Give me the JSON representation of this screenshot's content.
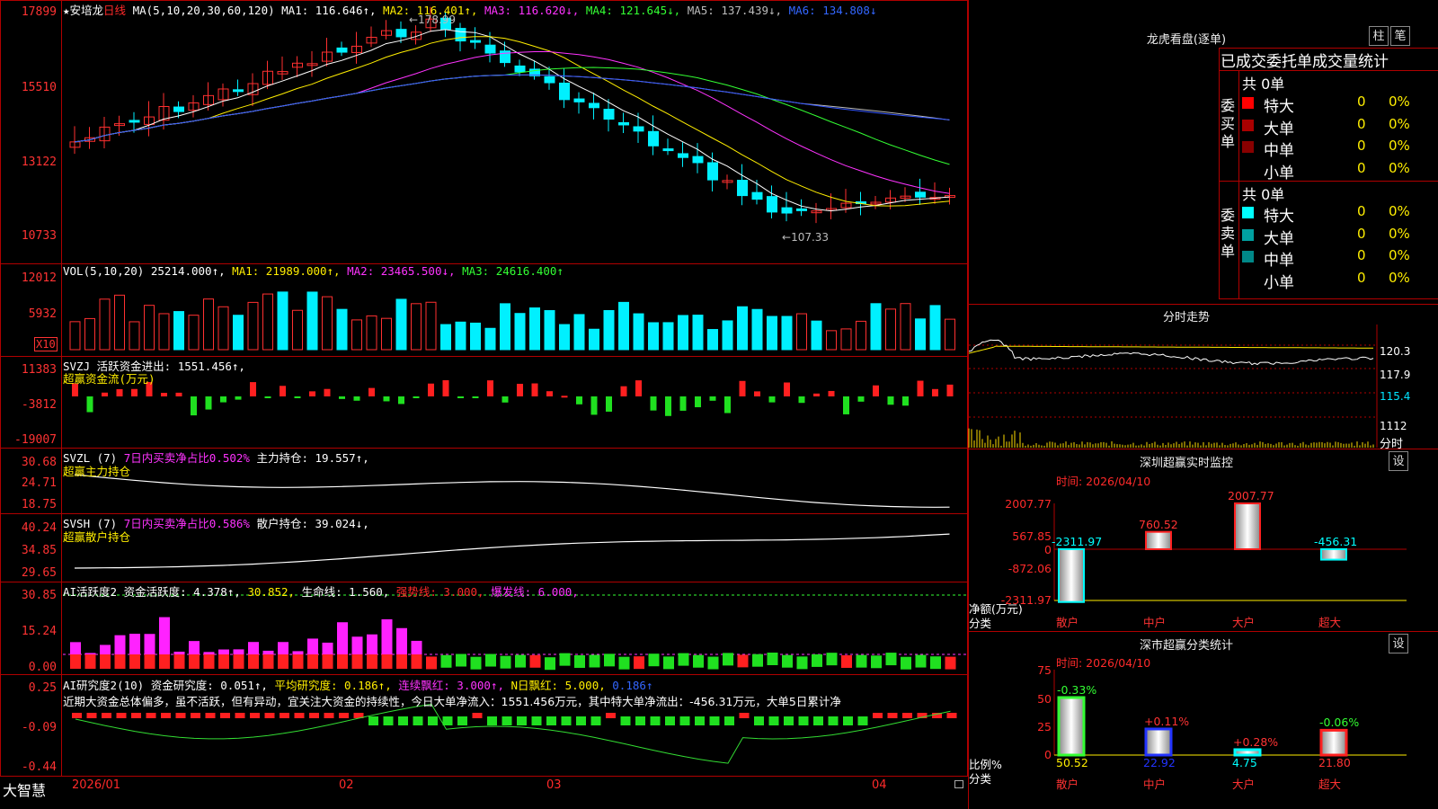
{
  "header": {
    "stock_name": "★安培龙",
    "period": "日线",
    "ma_label": "MA(5,10,20,30,60,120)",
    "ma1": "MA1: 116.646↑,",
    "ma2": "MA2: 116.401↑,",
    "ma3": "MA3: 116.620↓,",
    "ma4": "MA4: 121.645↓,",
    "ma5": "MA5: 137.439↓,",
    "ma6": "MA6: 134.808↓",
    "high_mark": "178.99",
    "low_mark": "107.33"
  },
  "price_axis": [
    "17899",
    "15510",
    "13122",
    "10733"
  ],
  "vol": {
    "label": "VOL(5,10,20)",
    "value": "25214.000↑,",
    "ma1": "MA1: 21989.000↑,",
    "ma2": "MA2: 23465.500↓,",
    "ma3": "MA3: 24616.400↑",
    "axis": [
      "12012",
      "5932"
    ],
    "unit": "X10"
  },
  "svzj": {
    "line1_a": "SVZJ  活跃资金进出: ",
    "line1_b": "1551.456↑,",
    "line2": "超赢资金流(万元)",
    "axis": [
      "11383",
      "-3812",
      "-19007"
    ]
  },
  "svzl": {
    "label": "SVZL (7)",
    "part1": "7日内买卖净占比0.502%",
    "part2": "主力持仓: 19.557↑,",
    "line2": "超赢主力持仓",
    "axis": [
      "30.68",
      "24.71",
      "18.75"
    ]
  },
  "svsh": {
    "label": "SVSH (7)",
    "part1": "7日内买卖净占比0.586%",
    "part2": "散户持仓: 39.024↓,",
    "line2": "超赢散户持仓",
    "axis": [
      "40.24",
      "34.85",
      "29.65"
    ]
  },
  "ai1": {
    "label": "AI活跃度2",
    "a": "资金活跃度: 4.378↑,",
    "b": "30.852,",
    "c": "生命线: 1.560,",
    "d": "强势线: 3.000,",
    "e": "爆发线: 6.000,",
    "axis": [
      "30.85",
      "15.24",
      "0.00"
    ]
  },
  "ai2": {
    "label": "AI研究度2(10)",
    "a": "资金研究度: 0.051↑,",
    "b": "平均研究度: 0.186↑,",
    "c": "连续飘红: 3.000↑,",
    "d": "N日飘红: 5.000,",
    "e": "0.186↑",
    "comment": "近期大资金总体偏多，虽不活跃，但有异动，宜关注大资金的持续性，今日大单净流入：1551.456万元，其中特大单净流出：-456.31万元，大单5日累计净",
    "axis": [
      "0.25",
      "-0.09",
      "-0.44"
    ]
  },
  "bottom": {
    "brand": "大智慧",
    "dates": [
      "2026/01",
      "02",
      "03",
      "04"
    ]
  },
  "dragon": {
    "title": "龙虎看盘(逐单)",
    "btn1": "柱",
    "btn2": "笔",
    "subtitle": "已成交委托单成交量统计",
    "buy_side": "委买单",
    "sell_side": "委卖单",
    "buy_total": "共 0单",
    "sell_total": "共 0单",
    "buy_rows": [
      {
        "name": "特大",
        "n": "0",
        "pct": "0%"
      },
      {
        "name": "大单",
        "n": "0",
        "pct": "0%"
      },
      {
        "name": "中单",
        "n": "0",
        "pct": "0%"
      },
      {
        "name": "小单",
        "n": "0",
        "pct": "0%"
      }
    ],
    "sell_rows": [
      {
        "name": "特大",
        "n": "0",
        "pct": "0%"
      },
      {
        "name": "大单",
        "n": "0",
        "pct": "0%"
      },
      {
        "name": "中单",
        "n": "0",
        "pct": "0%"
      },
      {
        "name": "小单",
        "n": "0",
        "pct": "0%"
      }
    ]
  },
  "minute": {
    "title": "分时走势",
    "axis": [
      "120.3",
      "117.9",
      "115.4",
      "1112"
    ],
    "foot": "分时"
  },
  "sz_monitor": {
    "title": "深圳超赢实时监控",
    "btn": "设",
    "time": "时间: 2026/04/10",
    "axis": [
      "2007.77",
      "567.85",
      "0",
      "-872.06",
      "-2311.97"
    ],
    "ylabel1": "净额(万元)",
    "ylabel2": "分类",
    "values": [
      "-2311.97",
      "760.52",
      "2007.77",
      "-456.31"
    ],
    "cats": [
      "散户",
      "中户",
      "大户",
      "超大"
    ]
  },
  "sz_class": {
    "title": "深市超赢分类统计",
    "btn": "设",
    "time": "时间: 2026/04/10",
    "axis": [
      "75",
      "50",
      "25",
      "0"
    ],
    "ylabel1": "比例%",
    "ylabel2": "分类",
    "pcts": [
      "-0.33%",
      "+0.11%",
      "+0.28%",
      "-0.06%"
    ],
    "values": [
      "50.52",
      "22.92",
      "4.75",
      "21.80"
    ],
    "cats": [
      "散户",
      "中户",
      "大户",
      "超大"
    ]
  }
}
